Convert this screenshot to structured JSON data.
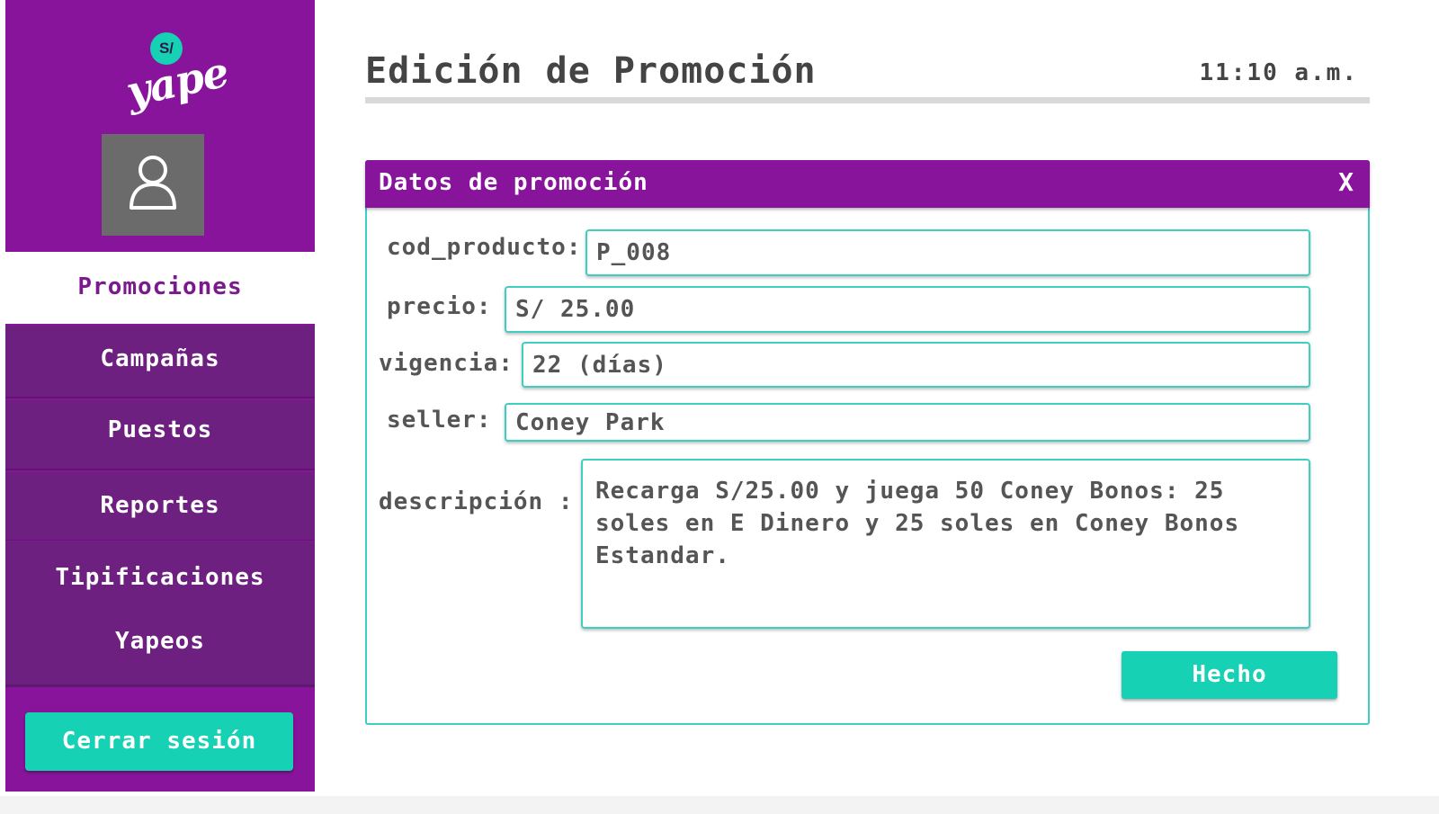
{
  "brand": {
    "name": "yape",
    "badge": "S/",
    "colors": {
      "purple": "#88149c",
      "teal": "#17d1b4",
      "nav_dark": "#6d2080"
    }
  },
  "sidebar": {
    "avatar_icon": "user-icon",
    "items": [
      {
        "label": "Promociones",
        "active": true
      },
      {
        "label": "Campañas",
        "active": false
      },
      {
        "label": "Puestos",
        "active": false
      },
      {
        "label": "Reportes",
        "active": false
      },
      {
        "label": "Tipificaciones",
        "active": false
      },
      {
        "label": "Yapeos",
        "active": false
      }
    ],
    "logout_label": "Cerrar sesión"
  },
  "header": {
    "title": "Edición de Promoción",
    "time": "11:10 a.m."
  },
  "card": {
    "title": "Datos de promoción",
    "close_label": "X",
    "fields": {
      "cod_producto": {
        "label": "cod_producto:",
        "value": "P_008"
      },
      "precio": {
        "label": "precio:",
        "value": "S/ 25.00"
      },
      "vigencia": {
        "label": "vigencia:",
        "value": "22 (días)"
      },
      "seller": {
        "label": "seller:",
        "value": "Coney Park"
      },
      "descripcion": {
        "label": "descripción :",
        "value": "Recarga S/25.00 y juega 50 Coney Bonos: 25 soles en E Dinero y 25 soles en Coney Bonos Estandar."
      }
    },
    "done_label": "Hecho"
  }
}
